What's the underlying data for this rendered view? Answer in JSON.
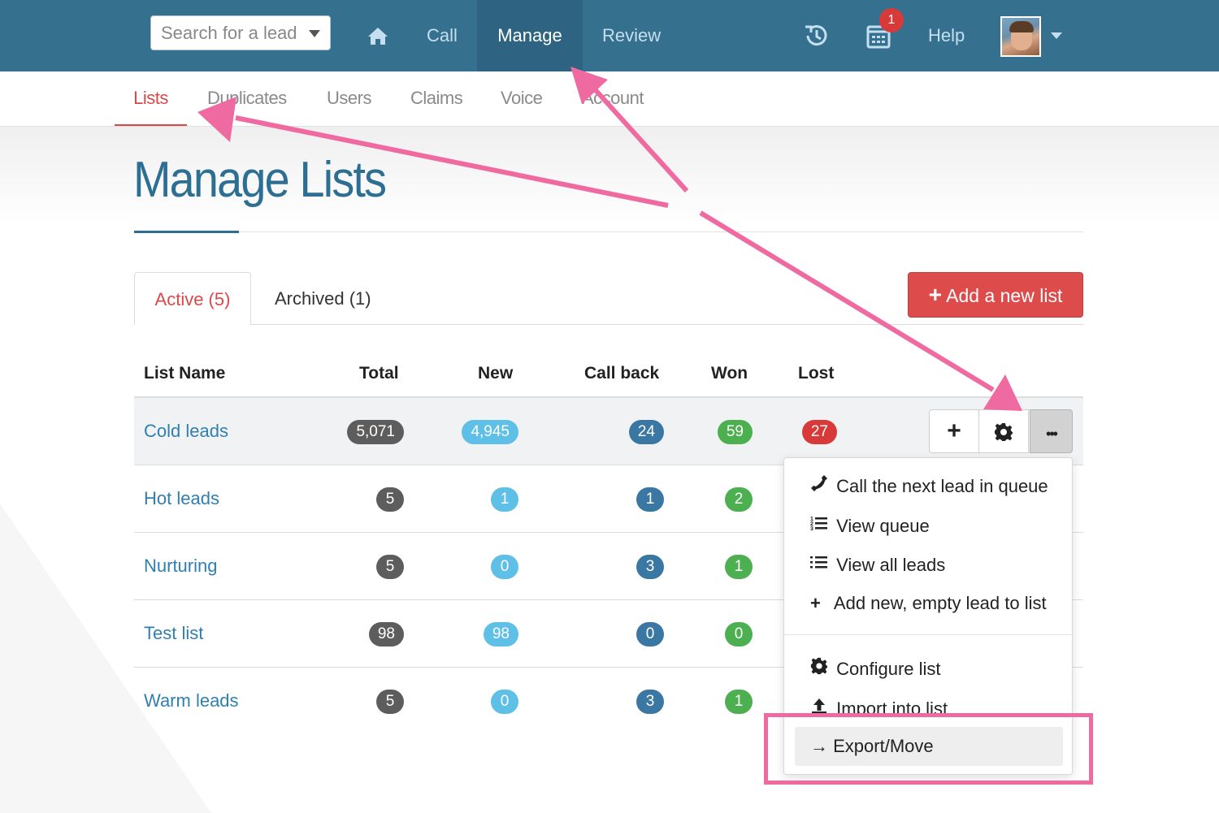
{
  "topbar": {
    "search_placeholder": "Search for a lead",
    "nav": {
      "home_icon": "home-icon",
      "call": "Call",
      "manage": "Manage",
      "review": "Review",
      "help": "Help"
    },
    "history_icon": "history-icon",
    "calendar_icon": "calendar-icon",
    "notification_count": "1",
    "avatar": "user-avatar"
  },
  "subnav": {
    "items": [
      "Lists",
      "Duplicates",
      "Users",
      "Claims",
      "Voice",
      "Account"
    ],
    "active": "Lists"
  },
  "page": {
    "title": "Manage Lists"
  },
  "tabs": {
    "active": "Active (5)",
    "archived": "Archived (1)"
  },
  "add_button": {
    "icon": "+",
    "label": "Add a new list"
  },
  "table": {
    "columns": [
      "List Name",
      "Total",
      "New",
      "Call back",
      "Won",
      "Lost"
    ],
    "rows": [
      {
        "name": "Cold leads",
        "total": "5,071",
        "new": "4,945",
        "call_back": "24",
        "won": "59",
        "lost": "27"
      },
      {
        "name": "Hot leads",
        "total": "5",
        "new": "1",
        "call_back": "1",
        "won": "2"
      },
      {
        "name": "Nurturing",
        "total": "5",
        "new": "0",
        "call_back": "3",
        "won": "1"
      },
      {
        "name": "Test list",
        "total": "98",
        "new": "98",
        "call_back": "0",
        "won": "0"
      },
      {
        "name": "Warm leads",
        "total": "5",
        "new": "0",
        "call_back": "3",
        "won": "1"
      }
    ]
  },
  "row_actions": {
    "add_icon": "+",
    "gear_icon": "gear-icon",
    "more_icon": "•••"
  },
  "menu": {
    "items": [
      {
        "icon": "phone-icon",
        "label": "Call the next lead in queue"
      },
      {
        "icon": "ordered-list-icon",
        "label": "View queue"
      },
      {
        "icon": "list-icon",
        "label": "View all leads"
      },
      {
        "icon": "plus-icon",
        "label": "Add new, empty lead to list"
      },
      {
        "icon": "gear-icon",
        "label": "Configure list"
      },
      {
        "icon": "upload-icon",
        "label": "Import into list"
      },
      {
        "icon": "arrow-right-icon",
        "label": "Export/Move"
      }
    ]
  },
  "colors": {
    "topbar": "#36708f",
    "accent_red": "#dd4b4b",
    "link_blue": "#2f7fb0",
    "annotation_pink": "#ef6aa1"
  }
}
